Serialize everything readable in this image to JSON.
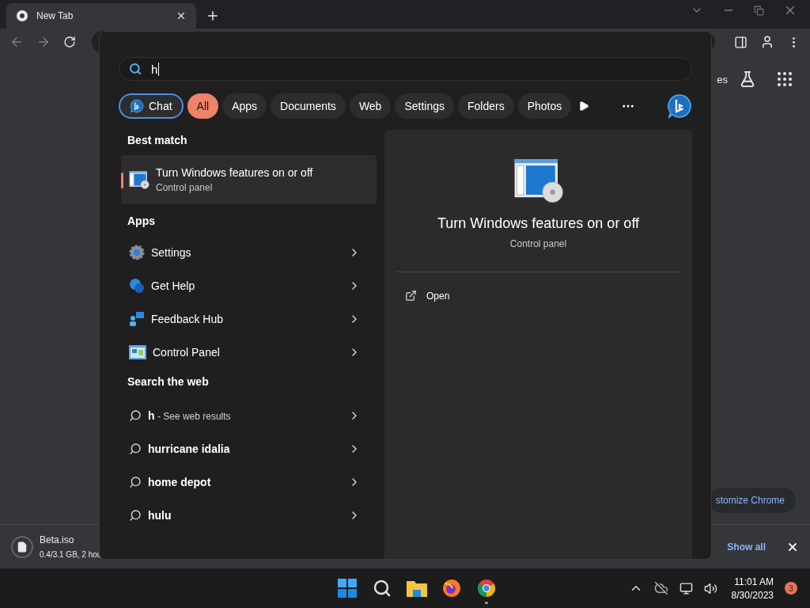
{
  "browser": {
    "tab": {
      "title": "New Tab",
      "selected": true
    },
    "toolbar_partial_text": "es",
    "customize_button": "stomize Chrome"
  },
  "download": {
    "filename": "Beta.iso",
    "status": "0.4/3.1 GB, 2 hou",
    "show_all": "Show all"
  },
  "search": {
    "query": "h",
    "filters": [
      {
        "label": "Chat",
        "kind": "chat",
        "selected": false
      },
      {
        "label": "All",
        "kind": "text",
        "selected": true
      },
      {
        "label": "Apps",
        "kind": "text",
        "selected": false
      },
      {
        "label": "Documents",
        "kind": "text",
        "selected": false
      },
      {
        "label": "Web",
        "kind": "text",
        "selected": false
      },
      {
        "label": "Settings",
        "kind": "text",
        "selected": false
      },
      {
        "label": "Folders",
        "kind": "text",
        "selected": false
      },
      {
        "label": "Photos",
        "kind": "text",
        "selected": false
      }
    ],
    "best_match_heading": "Best match",
    "best_match": {
      "title": "Turn Windows features on or off",
      "subtitle": "Control panel",
      "selected": true
    },
    "apps_heading": "Apps",
    "apps": [
      {
        "label": "Settings",
        "kind": "settings"
      },
      {
        "label": "Get Help",
        "kind": "help"
      },
      {
        "label": "Feedback Hub",
        "kind": "feedback"
      },
      {
        "label": "Control Panel",
        "kind": "control"
      }
    ],
    "web_heading": "Search the web",
    "web_results": [
      {
        "query": "h",
        "suffix": " - See web results"
      },
      {
        "query": "hurricane idalia"
      },
      {
        "query": "home depot"
      },
      {
        "query": "hulu"
      }
    ],
    "preview": {
      "title": "Turn Windows features on or off",
      "subtitle": "Control panel",
      "actions": [
        {
          "label": "Open"
        }
      ]
    }
  },
  "taskbar": {
    "apps": [
      {
        "kind": "start",
        "running": false
      },
      {
        "kind": "search",
        "running": false
      },
      {
        "kind": "files",
        "running": false
      },
      {
        "kind": "firefox",
        "running": false
      },
      {
        "kind": "chrome",
        "running": true
      }
    ],
    "time": "11:01 AM",
    "date": "8/30/2023",
    "notification_count": "3"
  }
}
